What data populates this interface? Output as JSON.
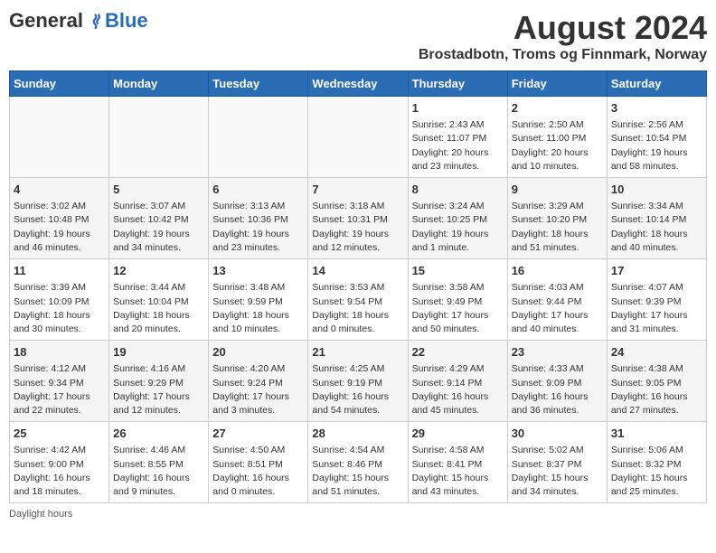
{
  "header": {
    "logo_general": "General",
    "logo_blue": "Blue",
    "main_title": "August 2024",
    "subtitle": "Brostadbotn, Troms og Finnmark, Norway"
  },
  "days_of_week": [
    "Sunday",
    "Monday",
    "Tuesday",
    "Wednesday",
    "Thursday",
    "Friday",
    "Saturday"
  ],
  "footer": {
    "daylight_label": "Daylight hours"
  },
  "weeks": [
    {
      "days": [
        {
          "num": "",
          "info": ""
        },
        {
          "num": "",
          "info": ""
        },
        {
          "num": "",
          "info": ""
        },
        {
          "num": "",
          "info": ""
        },
        {
          "num": "1",
          "info": "Sunrise: 2:43 AM\nSunset: 11:07 PM\nDaylight: 20 hours\nand 23 minutes."
        },
        {
          "num": "2",
          "info": "Sunrise: 2:50 AM\nSunset: 11:00 PM\nDaylight: 20 hours\nand 10 minutes."
        },
        {
          "num": "3",
          "info": "Sunrise: 2:56 AM\nSunset: 10:54 PM\nDaylight: 19 hours\nand 58 minutes."
        }
      ]
    },
    {
      "days": [
        {
          "num": "4",
          "info": "Sunrise: 3:02 AM\nSunset: 10:48 PM\nDaylight: 19 hours\nand 46 minutes."
        },
        {
          "num": "5",
          "info": "Sunrise: 3:07 AM\nSunset: 10:42 PM\nDaylight: 19 hours\nand 34 minutes."
        },
        {
          "num": "6",
          "info": "Sunrise: 3:13 AM\nSunset: 10:36 PM\nDaylight: 19 hours\nand 23 minutes."
        },
        {
          "num": "7",
          "info": "Sunrise: 3:18 AM\nSunset: 10:31 PM\nDaylight: 19 hours\nand 12 minutes."
        },
        {
          "num": "8",
          "info": "Sunrise: 3:24 AM\nSunset: 10:25 PM\nDaylight: 19 hours\nand 1 minute."
        },
        {
          "num": "9",
          "info": "Sunrise: 3:29 AM\nSunset: 10:20 PM\nDaylight: 18 hours\nand 51 minutes."
        },
        {
          "num": "10",
          "info": "Sunrise: 3:34 AM\nSunset: 10:14 PM\nDaylight: 18 hours\nand 40 minutes."
        }
      ]
    },
    {
      "days": [
        {
          "num": "11",
          "info": "Sunrise: 3:39 AM\nSunset: 10:09 PM\nDaylight: 18 hours\nand 30 minutes."
        },
        {
          "num": "12",
          "info": "Sunrise: 3:44 AM\nSunset: 10:04 PM\nDaylight: 18 hours\nand 20 minutes."
        },
        {
          "num": "13",
          "info": "Sunrise: 3:48 AM\nSunset: 9:59 PM\nDaylight: 18 hours\nand 10 minutes."
        },
        {
          "num": "14",
          "info": "Sunrise: 3:53 AM\nSunset: 9:54 PM\nDaylight: 18 hours\nand 0 minutes."
        },
        {
          "num": "15",
          "info": "Sunrise: 3:58 AM\nSunset: 9:49 PM\nDaylight: 17 hours\nand 50 minutes."
        },
        {
          "num": "16",
          "info": "Sunrise: 4:03 AM\nSunset: 9:44 PM\nDaylight: 17 hours\nand 40 minutes."
        },
        {
          "num": "17",
          "info": "Sunrise: 4:07 AM\nSunset: 9:39 PM\nDaylight: 17 hours\nand 31 minutes."
        }
      ]
    },
    {
      "days": [
        {
          "num": "18",
          "info": "Sunrise: 4:12 AM\nSunset: 9:34 PM\nDaylight: 17 hours\nand 22 minutes."
        },
        {
          "num": "19",
          "info": "Sunrise: 4:16 AM\nSunset: 9:29 PM\nDaylight: 17 hours\nand 12 minutes."
        },
        {
          "num": "20",
          "info": "Sunrise: 4:20 AM\nSunset: 9:24 PM\nDaylight: 17 hours\nand 3 minutes."
        },
        {
          "num": "21",
          "info": "Sunrise: 4:25 AM\nSunset: 9:19 PM\nDaylight: 16 hours\nand 54 minutes."
        },
        {
          "num": "22",
          "info": "Sunrise: 4:29 AM\nSunset: 9:14 PM\nDaylight: 16 hours\nand 45 minutes."
        },
        {
          "num": "23",
          "info": "Sunrise: 4:33 AM\nSunset: 9:09 PM\nDaylight: 16 hours\nand 36 minutes."
        },
        {
          "num": "24",
          "info": "Sunrise: 4:38 AM\nSunset: 9:05 PM\nDaylight: 16 hours\nand 27 minutes."
        }
      ]
    },
    {
      "days": [
        {
          "num": "25",
          "info": "Sunrise: 4:42 AM\nSunset: 9:00 PM\nDaylight: 16 hours\nand 18 minutes."
        },
        {
          "num": "26",
          "info": "Sunrise: 4:46 AM\nSunset: 8:55 PM\nDaylight: 16 hours\nand 9 minutes."
        },
        {
          "num": "27",
          "info": "Sunrise: 4:50 AM\nSunset: 8:51 PM\nDaylight: 16 hours\nand 0 minutes."
        },
        {
          "num": "28",
          "info": "Sunrise: 4:54 AM\nSunset: 8:46 PM\nDaylight: 15 hours\nand 51 minutes."
        },
        {
          "num": "29",
          "info": "Sunrise: 4:58 AM\nSunset: 8:41 PM\nDaylight: 15 hours\nand 43 minutes."
        },
        {
          "num": "30",
          "info": "Sunrise: 5:02 AM\nSunset: 8:37 PM\nDaylight: 15 hours\nand 34 minutes."
        },
        {
          "num": "31",
          "info": "Sunrise: 5:06 AM\nSunset: 8:32 PM\nDaylight: 15 hours\nand 25 minutes."
        }
      ]
    }
  ]
}
